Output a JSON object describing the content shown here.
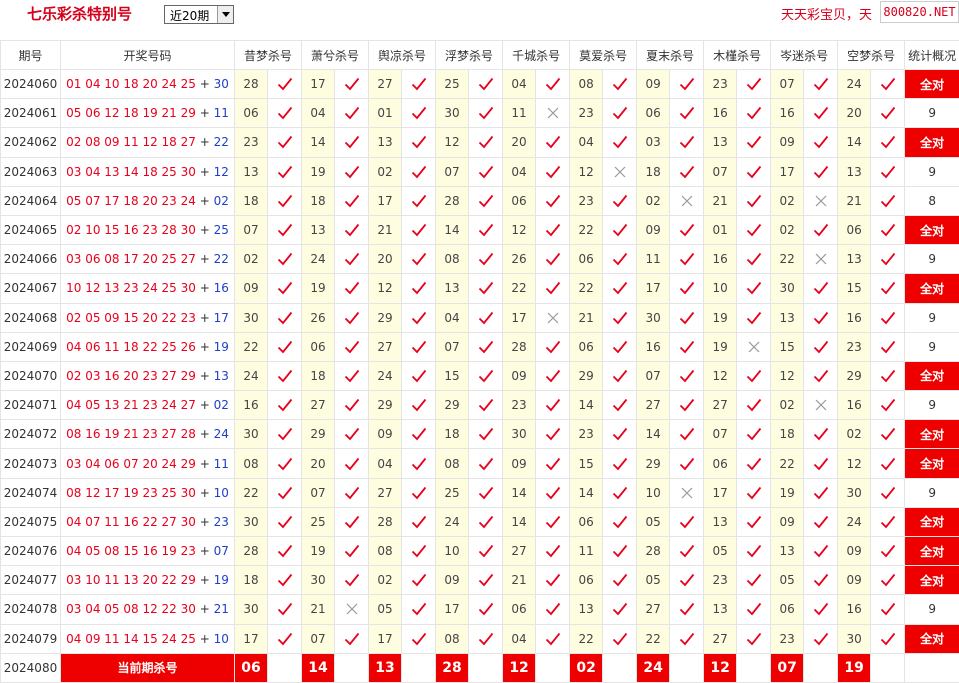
{
  "header": {
    "title": "七乐彩杀特别号",
    "period_selected": "近20期",
    "marquee": "天天彩宝贝，天",
    "brand": "800820.NET"
  },
  "columns": {
    "issue": "期号",
    "draw": "开奖号码",
    "experts": [
      "昔梦杀号",
      "萧兮杀号",
      "舆凉杀号",
      "浮梦杀号",
      "千城杀号",
      "莫爱杀号",
      "夏末杀号",
      "木槿杀号",
      "岑迷杀号",
      "空梦杀号"
    ],
    "stat": "统计概况"
  },
  "icons": {
    "hit": "check-icon",
    "miss": "cross-icon"
  },
  "colors": {
    "red": "#e8001c",
    "blue": "#1e3fc8",
    "highlight": "#ee0000",
    "cell_bg": "#fffde0"
  },
  "rows": [
    {
      "issue": "2024060",
      "main": "01 04 10 18 20 24 25",
      "special": "30",
      "kills": [
        "28",
        "17",
        "27",
        "25",
        "04",
        "08",
        "09",
        "23",
        "07",
        "24"
      ],
      "hits": [
        1,
        1,
        1,
        1,
        1,
        1,
        1,
        1,
        1,
        1
      ],
      "stat": "全对"
    },
    {
      "issue": "2024061",
      "main": "05 06 12 18 19 21 29",
      "special": "11",
      "kills": [
        "06",
        "04",
        "01",
        "30",
        "11",
        "23",
        "06",
        "16",
        "16",
        "20"
      ],
      "hits": [
        1,
        1,
        1,
        1,
        0,
        1,
        1,
        1,
        1,
        1
      ],
      "stat": "9"
    },
    {
      "issue": "2024062",
      "main": "02 08 09 11 12 18 27",
      "special": "22",
      "kills": [
        "23",
        "14",
        "13",
        "12",
        "20",
        "04",
        "03",
        "13",
        "09",
        "14"
      ],
      "hits": [
        1,
        1,
        1,
        1,
        1,
        1,
        1,
        1,
        1,
        1
      ],
      "stat": "全对"
    },
    {
      "issue": "2024063",
      "main": "03 04 13 14 18 25 30",
      "special": "12",
      "kills": [
        "13",
        "19",
        "02",
        "07",
        "04",
        "12",
        "18",
        "07",
        "17",
        "13"
      ],
      "hits": [
        1,
        1,
        1,
        1,
        1,
        0,
        1,
        1,
        1,
        1
      ],
      "stat": "9"
    },
    {
      "issue": "2024064",
      "main": "05 07 17 18 20 23 24",
      "special": "02",
      "kills": [
        "18",
        "18",
        "17",
        "28",
        "06",
        "23",
        "02",
        "21",
        "02",
        "21"
      ],
      "hits": [
        1,
        1,
        1,
        1,
        1,
        1,
        0,
        1,
        0,
        1
      ],
      "stat": "8"
    },
    {
      "issue": "2024065",
      "main": "02 10 15 16 23 28 30",
      "special": "25",
      "kills": [
        "07",
        "13",
        "21",
        "14",
        "12",
        "22",
        "09",
        "01",
        "02",
        "06"
      ],
      "hits": [
        1,
        1,
        1,
        1,
        1,
        1,
        1,
        1,
        1,
        1
      ],
      "stat": "全对"
    },
    {
      "issue": "2024066",
      "main": "03 06 08 17 20 25 27",
      "special": "22",
      "kills": [
        "02",
        "24",
        "20",
        "08",
        "26",
        "06",
        "11",
        "16",
        "22",
        "13"
      ],
      "hits": [
        1,
        1,
        1,
        1,
        1,
        1,
        1,
        1,
        0,
        1
      ],
      "stat": "9"
    },
    {
      "issue": "2024067",
      "main": "10 12 13 23 24 25 30",
      "special": "16",
      "kills": [
        "09",
        "19",
        "12",
        "13",
        "22",
        "22",
        "17",
        "10",
        "30",
        "15"
      ],
      "hits": [
        1,
        1,
        1,
        1,
        1,
        1,
        1,
        1,
        1,
        1
      ],
      "stat": "全对"
    },
    {
      "issue": "2024068",
      "main": "02 05 09 15 20 22 23",
      "special": "17",
      "kills": [
        "30",
        "26",
        "29",
        "04",
        "17",
        "21",
        "30",
        "19",
        "13",
        "16"
      ],
      "hits": [
        1,
        1,
        1,
        1,
        0,
        1,
        1,
        1,
        1,
        1
      ],
      "stat": "9"
    },
    {
      "issue": "2024069",
      "main": "04 06 11 18 22 25 26",
      "special": "19",
      "kills": [
        "22",
        "06",
        "27",
        "07",
        "28",
        "06",
        "16",
        "19",
        "15",
        "23"
      ],
      "hits": [
        1,
        1,
        1,
        1,
        1,
        1,
        1,
        0,
        1,
        1
      ],
      "stat": "9"
    },
    {
      "issue": "2024070",
      "main": "02 03 16 20 23 27 29",
      "special": "13",
      "kills": [
        "24",
        "18",
        "24",
        "15",
        "09",
        "29",
        "07",
        "12",
        "12",
        "29"
      ],
      "hits": [
        1,
        1,
        1,
        1,
        1,
        1,
        1,
        1,
        1,
        1
      ],
      "stat": "全对"
    },
    {
      "issue": "2024071",
      "main": "04 05 13 21 23 24 27",
      "special": "02",
      "kills": [
        "16",
        "27",
        "29",
        "29",
        "23",
        "14",
        "27",
        "27",
        "02",
        "16"
      ],
      "hits": [
        1,
        1,
        1,
        1,
        1,
        1,
        1,
        1,
        0,
        1
      ],
      "stat": "9"
    },
    {
      "issue": "2024072",
      "main": "08 16 19 21 23 27 28",
      "special": "24",
      "kills": [
        "30",
        "29",
        "09",
        "18",
        "30",
        "23",
        "14",
        "07",
        "18",
        "02"
      ],
      "hits": [
        1,
        1,
        1,
        1,
        1,
        1,
        1,
        1,
        1,
        1
      ],
      "stat": "全对"
    },
    {
      "issue": "2024073",
      "main": "03 04 06 07 20 24 29",
      "special": "11",
      "kills": [
        "08",
        "20",
        "04",
        "08",
        "09",
        "15",
        "29",
        "06",
        "22",
        "12"
      ],
      "hits": [
        1,
        1,
        1,
        1,
        1,
        1,
        1,
        1,
        1,
        1
      ],
      "stat": "全对"
    },
    {
      "issue": "2024074",
      "main": "08 12 17 19 23 25 30",
      "special": "10",
      "kills": [
        "22",
        "07",
        "27",
        "25",
        "14",
        "14",
        "10",
        "17",
        "19",
        "30"
      ],
      "hits": [
        1,
        1,
        1,
        1,
        1,
        1,
        0,
        1,
        1,
        1
      ],
      "stat": "9"
    },
    {
      "issue": "2024075",
      "main": "04 07 11 16 22 27 30",
      "special": "23",
      "kills": [
        "30",
        "25",
        "28",
        "24",
        "14",
        "06",
        "05",
        "13",
        "09",
        "24"
      ],
      "hits": [
        1,
        1,
        1,
        1,
        1,
        1,
        1,
        1,
        1,
        1
      ],
      "stat": "全对"
    },
    {
      "issue": "2024076",
      "main": "04 05 08 15 16 19 23",
      "special": "07",
      "kills": [
        "28",
        "19",
        "08",
        "10",
        "27",
        "11",
        "28",
        "05",
        "13",
        "09"
      ],
      "hits": [
        1,
        1,
        1,
        1,
        1,
        1,
        1,
        1,
        1,
        1
      ],
      "stat": "全对"
    },
    {
      "issue": "2024077",
      "main": "03 10 11 13 20 22 29",
      "special": "19",
      "kills": [
        "18",
        "30",
        "02",
        "09",
        "21",
        "06",
        "05",
        "23",
        "05",
        "09"
      ],
      "hits": [
        1,
        1,
        1,
        1,
        1,
        1,
        1,
        1,
        1,
        1
      ],
      "stat": "全对"
    },
    {
      "issue": "2024078",
      "main": "03 04 05 08 12 22 30",
      "special": "21",
      "kills": [
        "30",
        "21",
        "05",
        "17",
        "06",
        "13",
        "27",
        "13",
        "06",
        "16"
      ],
      "hits": [
        1,
        0,
        1,
        1,
        1,
        1,
        1,
        1,
        1,
        1
      ],
      "stat": "9"
    },
    {
      "issue": "2024079",
      "main": "04 09 11 14 15 24 25",
      "special": "10",
      "kills": [
        "17",
        "07",
        "17",
        "08",
        "04",
        "22",
        "22",
        "27",
        "23",
        "30"
      ],
      "hits": [
        1,
        1,
        1,
        1,
        1,
        1,
        1,
        1,
        1,
        1
      ],
      "stat": "全对"
    }
  ],
  "current": {
    "issue": "2024080",
    "label": "当前期杀号",
    "kills": [
      "06",
      "14",
      "13",
      "28",
      "12",
      "02",
      "24",
      "12",
      "07",
      "19"
    ]
  }
}
